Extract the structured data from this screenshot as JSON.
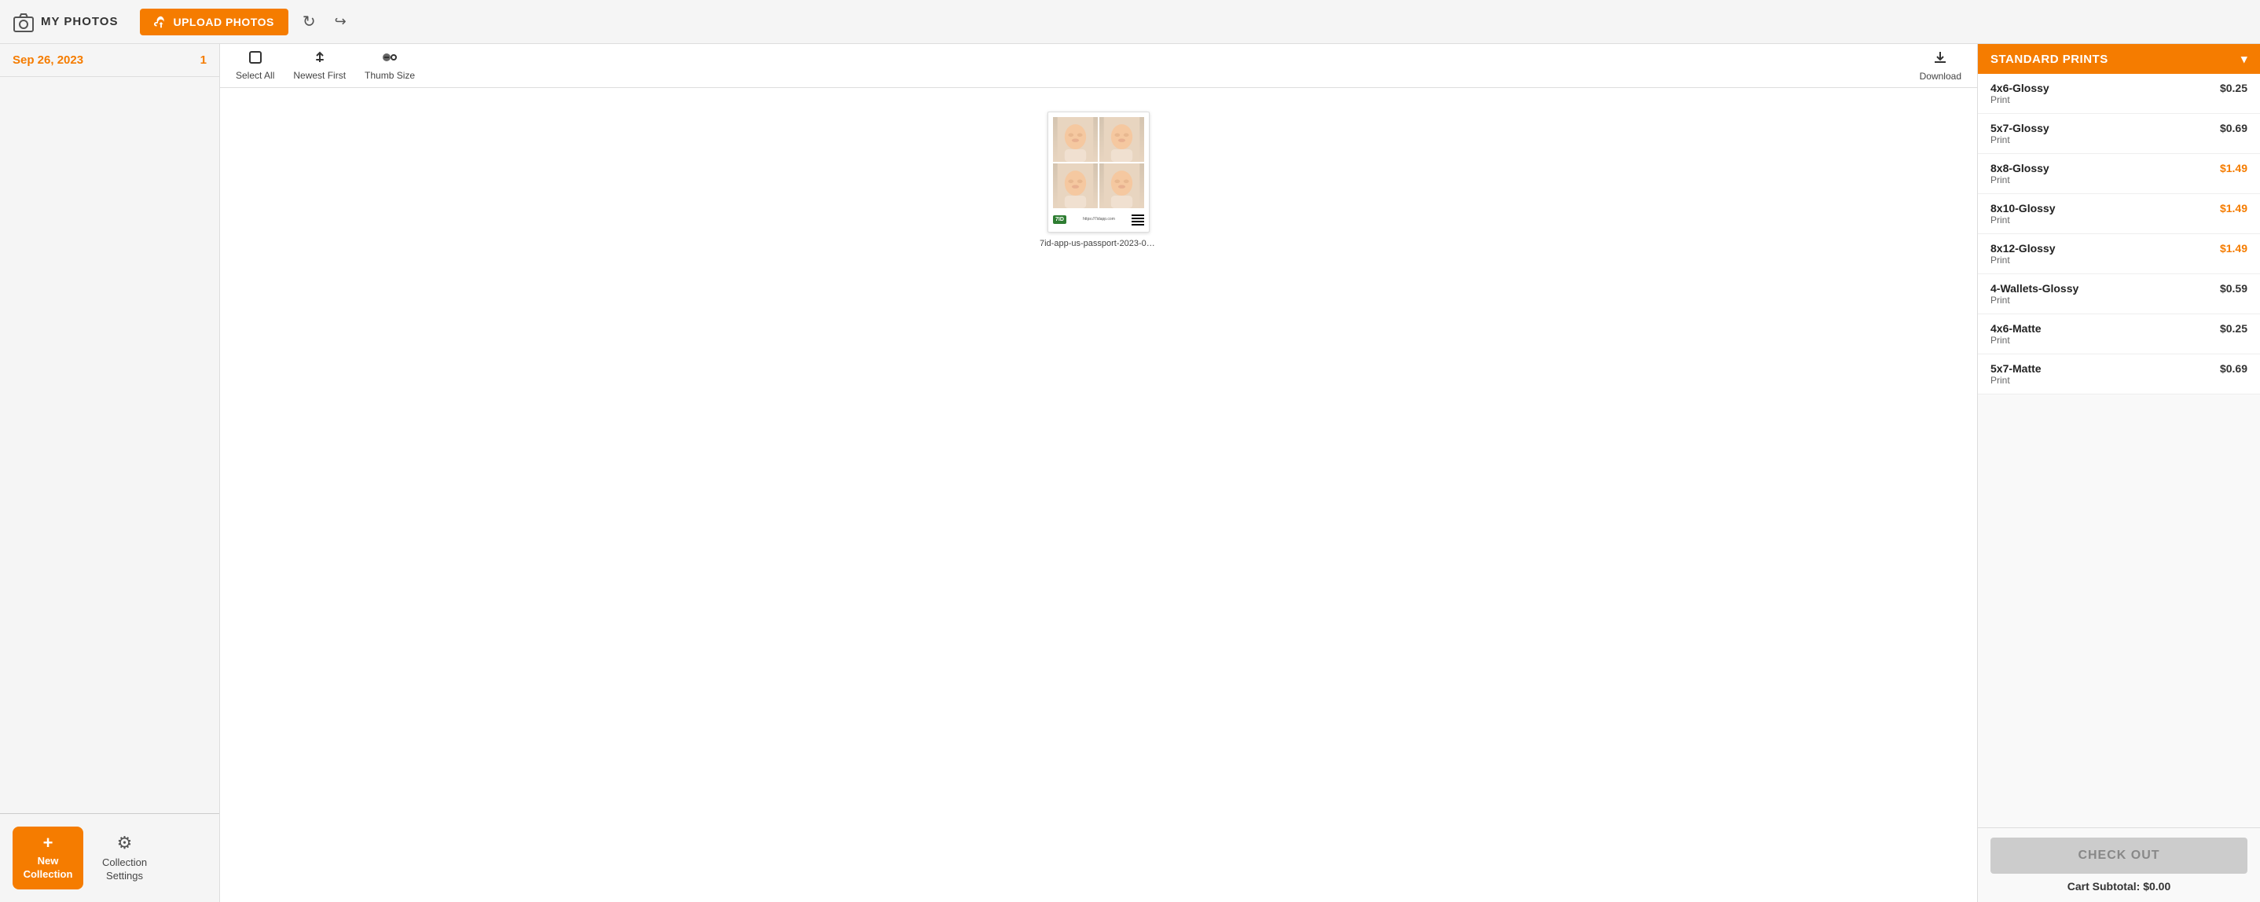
{
  "header": {
    "logo_label": "MY PHOTOS",
    "upload_label": "UPLOAD PHOTOS",
    "refresh_icon": "↻",
    "share_icon": "↪"
  },
  "sidebar": {
    "date": "Sep 26, 2023",
    "count": "1",
    "new_collection_label": "New\nCollection",
    "collection_settings_label": "Collection\nSettings"
  },
  "toolbar": {
    "select_all_label": "Select All",
    "newest_first_label": "Newest First",
    "thumb_size_label": "Thumb Size",
    "download_label": "Download"
  },
  "photo": {
    "filename": "7id-app-us-passport-2023-09..."
  },
  "right_panel": {
    "header_label": "STANDARD PRINTS",
    "chevron": "▾",
    "prints": [
      {
        "name": "4x6-Glossy",
        "type": "Print",
        "price": "$0.25",
        "highlight": false
      },
      {
        "name": "5x7-Glossy",
        "type": "Print",
        "price": "$0.69",
        "highlight": false
      },
      {
        "name": "8x8-Glossy",
        "type": "Print",
        "price": "$1.49",
        "highlight": true
      },
      {
        "name": "8x10-Glossy",
        "type": "Print",
        "price": "$1.49",
        "highlight": true
      },
      {
        "name": "8x12-Glossy",
        "type": "Print",
        "price": "$1.49",
        "highlight": true
      },
      {
        "name": "4-Wallets-Glossy",
        "type": "Print",
        "price": "$0.59",
        "highlight": false
      },
      {
        "name": "4x6-Matte",
        "type": "Print",
        "price": "$0.25",
        "highlight": false
      },
      {
        "name": "5x7-Matte",
        "type": "Print",
        "price": "$0.69",
        "highlight": false
      }
    ],
    "checkout_label": "CHECK OUT",
    "cart_subtotal": "Cart Subtotal: $0.00"
  }
}
